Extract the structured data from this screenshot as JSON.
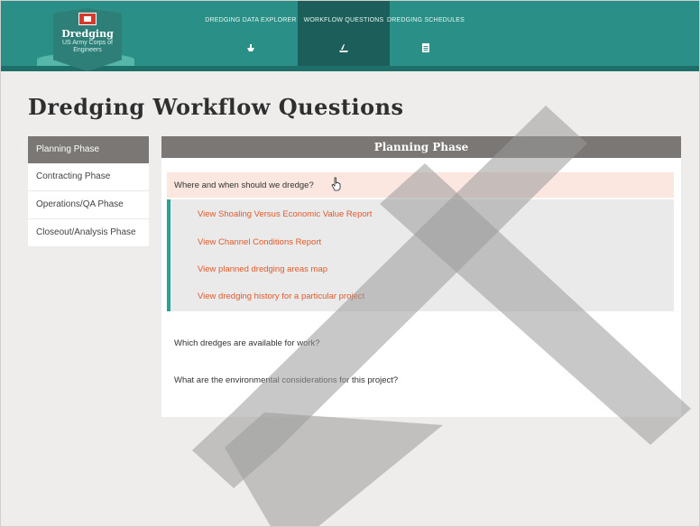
{
  "header": {
    "logo": {
      "title": "Dredging",
      "subtitle": "US Army Corps of Engineers",
      "icon": "castle-icon"
    },
    "nav": [
      {
        "label": "DREDGING DATA EXPLORER",
        "icon": "boat-icon",
        "active": false
      },
      {
        "label": "WORKFLOW QUESTIONS",
        "icon": "dredge-icon",
        "active": true
      },
      {
        "label": "DREDGING SCHEDULES",
        "icon": "clipboard-icon",
        "active": false
      }
    ]
  },
  "page": {
    "title": "Dredging Workflow Questions"
  },
  "sidebar": {
    "items": [
      {
        "label": "Planning Phase",
        "active": true
      },
      {
        "label": "Contracting Phase",
        "active": false
      },
      {
        "label": "Operations/QA Phase",
        "active": false
      },
      {
        "label": "Closeout/Analysis Phase",
        "active": false
      }
    ]
  },
  "main": {
    "heading": "Planning Phase",
    "questions": [
      {
        "text": "Where and when should we dredge?",
        "links": [
          "View Shoaling Versus Economic Value Report",
          "View Channel Conditions Report",
          "View planned dredging areas map",
          "View dredging history for a particular project"
        ]
      },
      {
        "text": "Which dredges are available for work?"
      },
      {
        "text": "What are the environmental considerations for this project?"
      }
    ]
  },
  "colors": {
    "header_teal": "#2a8f86",
    "nav_active": "#1c5f5a",
    "link_orange": "#e05a2a",
    "accent_teal": "#2aa196",
    "panel_gray": "#7a7774",
    "highlight_pink": "#fbe6e0"
  }
}
